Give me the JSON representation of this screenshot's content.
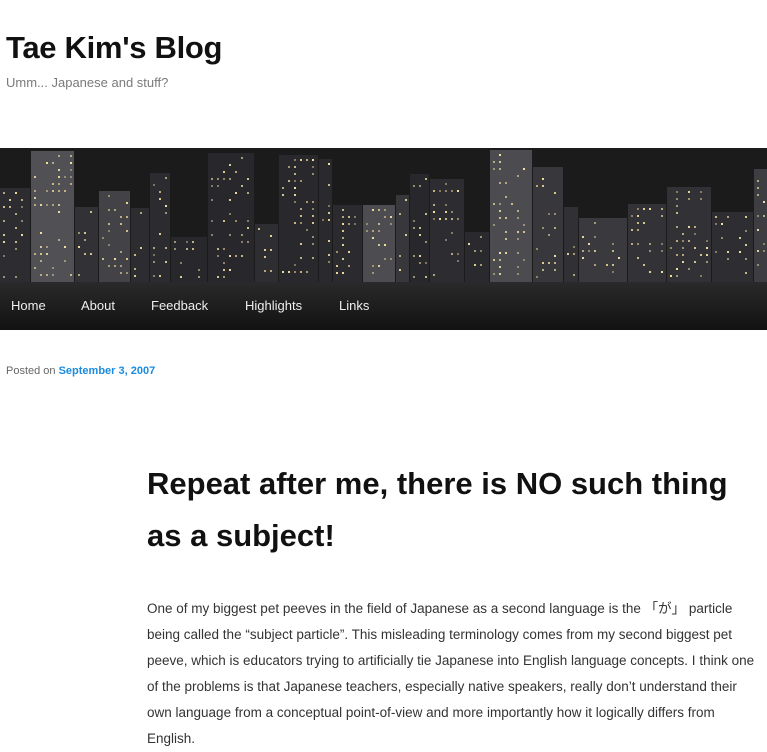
{
  "site": {
    "title": "Tae Kim's Blog",
    "tagline": "Umm... Japanese and stuff?"
  },
  "banner": {
    "image": "night-city-skyline-photo",
    "colors": {
      "sky": "#1b1b1b",
      "building": "#3b3b3b",
      "light": "#f5e2a0"
    }
  },
  "nav": {
    "items": [
      "Home",
      "About",
      "Feedback",
      "Highlights",
      "Links"
    ]
  },
  "post": {
    "meta_prefix": "Posted on ",
    "date": "September 3, 2007",
    "title": "Repeat after me, there is NO such thing as a subject!",
    "body": "One of my biggest pet peeves in the field of Japanese as a second language is the 「が」 particle being called the “subject particle”. This misleading terminology comes from my second biggest pet peeve, which is educators trying to artificially tie Japanese into English language concepts. I think one of the problems is that Japanese teachers, especially native speakers, really don’t understand their own language from a conceptual point-of-view and more importantly how it logically differs from English."
  },
  "colors": {
    "accent_link": "#1b8be0",
    "nav_background": "#1a1a1a",
    "title_text": "#111111"
  }
}
